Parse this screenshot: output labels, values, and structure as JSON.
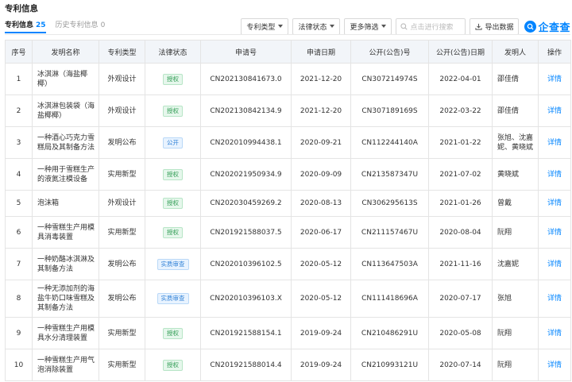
{
  "section_title": "专利信息",
  "tabs": [
    {
      "label": "专利信息",
      "count": "25",
      "active": true
    },
    {
      "label": "历史专利信息",
      "count": "0",
      "active": false
    }
  ],
  "toolbar": {
    "type_filter": "专利类型",
    "status_filter": "法律状态",
    "more_filter": "更多筛选",
    "search_placeholder": "点击进行搜索",
    "export_label": "导出数据",
    "logo_text": "企查查"
  },
  "table": {
    "headers": [
      "序号",
      "发明名称",
      "专利类型",
      "法律状态",
      "申请号",
      "申请日期",
      "公开(公告)号",
      "公开(公告)日期",
      "发明人",
      "操作"
    ],
    "rows": [
      {
        "no": "1",
        "name": "冰淇淋（海盐椰椰）",
        "type": "外观设计",
        "status": "授权",
        "status_kind": "grant",
        "app_no": "CN202130841673.0",
        "app_date": "2021-12-20",
        "pub_no": "CN307214974S",
        "pub_date": "2022-04-01",
        "inventor": "邵佳倩",
        "action": "详情"
      },
      {
        "no": "2",
        "name": "冰淇淋包装袋（海盐椰椰）",
        "type": "外观设计",
        "status": "授权",
        "status_kind": "grant",
        "app_no": "CN202130842134.9",
        "app_date": "2021-12-20",
        "pub_no": "CN307189169S",
        "pub_date": "2022-03-22",
        "inventor": "邵佳倩",
        "action": "详情"
      },
      {
        "no": "3",
        "name": "一种酒心巧克力雪糕局及其制备方法",
        "type": "发明公布",
        "status": "公开",
        "status_kind": "public",
        "app_no": "CN202010994438.1",
        "app_date": "2020-09-21",
        "pub_no": "CN112244140A",
        "pub_date": "2021-01-22",
        "inventor": "张旭、沈嘉妮、黄晓斌",
        "action": "详情"
      },
      {
        "no": "4",
        "name": "一种用于雪糕生产的液氮注模设备",
        "type": "实用新型",
        "status": "授权",
        "status_kind": "grant",
        "app_no": "CN202021950934.9",
        "app_date": "2020-09-09",
        "pub_no": "CN213587347U",
        "pub_date": "2021-07-02",
        "inventor": "黄晓斌",
        "action": "详情"
      },
      {
        "no": "5",
        "name": "泡沫箱",
        "type": "外观设计",
        "status": "授权",
        "status_kind": "grant",
        "app_no": "CN202030459269.2",
        "app_date": "2020-08-13",
        "pub_no": "CN306295613S",
        "pub_date": "2021-01-26",
        "inventor": "曾戴",
        "action": "详情"
      },
      {
        "no": "6",
        "name": "一种雪糕生产用模具消毒装置",
        "type": "实用新型",
        "status": "授权",
        "status_kind": "grant",
        "app_no": "CN201921588037.5",
        "app_date": "2020-06-17",
        "pub_no": "CN211157467U",
        "pub_date": "2020-08-04",
        "inventor": "阮翔",
        "action": "详情"
      },
      {
        "no": "7",
        "name": "一种奶酪冰淇淋及其制备方法",
        "type": "发明公布",
        "status": "实质审查",
        "status_kind": "review",
        "app_no": "CN202010396102.5",
        "app_date": "2020-05-12",
        "pub_no": "CN113647503A",
        "pub_date": "2021-11-16",
        "inventor": "沈嘉妮",
        "action": "详情"
      },
      {
        "no": "8",
        "name": "一种无添加剂的海盐牛奶口味雪糕及其制备方法",
        "type": "发明公布",
        "status": "实质审查",
        "status_kind": "review",
        "app_no": "CN202010396103.X",
        "app_date": "2020-05-12",
        "pub_no": "CN111418696A",
        "pub_date": "2020-07-17",
        "inventor": "张旭",
        "action": "详情"
      },
      {
        "no": "9",
        "name": "一种雪糕生产用模具水分清理装置",
        "type": "实用新型",
        "status": "授权",
        "status_kind": "grant",
        "app_no": "CN201921588154.1",
        "app_date": "2019-09-24",
        "pub_no": "CN210486291U",
        "pub_date": "2020-05-08",
        "inventor": "阮翔",
        "action": "详情"
      },
      {
        "no": "10",
        "name": "一种雪糕生产用气泡消除装置",
        "type": "实用新型",
        "status": "授权",
        "status_kind": "grant",
        "app_no": "CN201921588014.4",
        "app_date": "2019-09-24",
        "pub_no": "CN210993121U",
        "pub_date": "2020-07-14",
        "inventor": "阮翔",
        "action": "详情"
      }
    ]
  },
  "colors": {
    "accent": "#0084ff",
    "grant": "#2e9b52",
    "public": "#2f80d6",
    "header_bg": "#f2f5f9"
  }
}
